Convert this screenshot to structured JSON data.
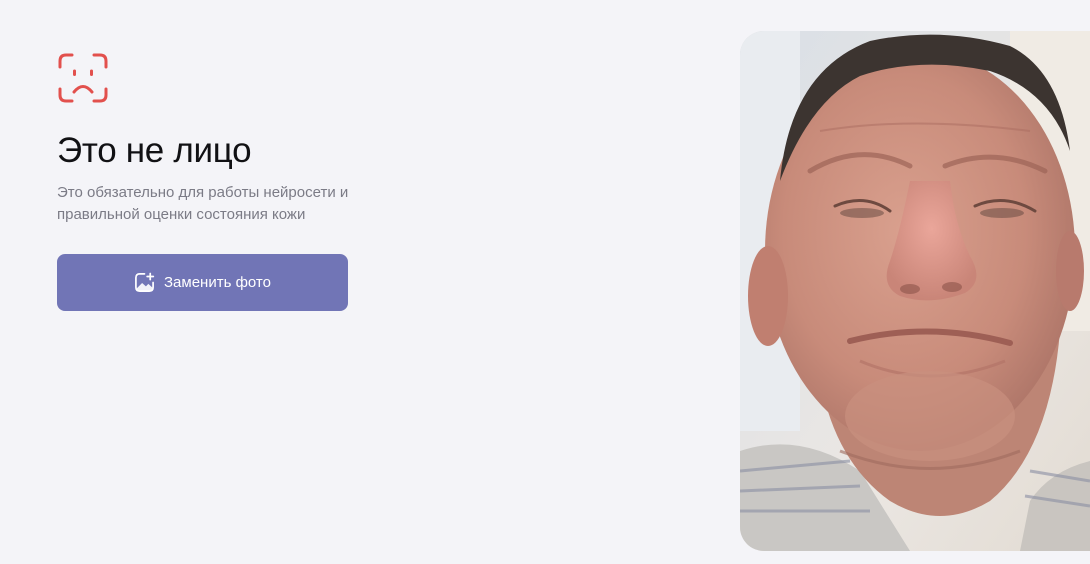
{
  "status": {
    "icon": "sad-face-scan-icon",
    "title": "Это не лицо",
    "description": "Это обязательно для работы нейросети и правильной оценки состояния кожи"
  },
  "actions": {
    "replace_photo_label": "Заменить фото",
    "replace_photo_icon": "add-photo-icon"
  },
  "photo": {
    "subject": "uploaded-selfie"
  },
  "colors": {
    "background": "#f4f4f8",
    "accent": "#7175b6",
    "icon_red": "#e2504d",
    "title": "#111114",
    "muted_text": "#7b7b86"
  }
}
